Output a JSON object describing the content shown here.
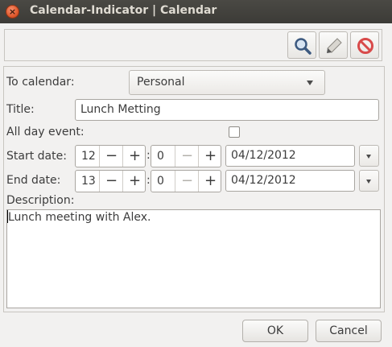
{
  "window": {
    "title": "Calendar-Indicator | Calendar",
    "close_glyph": "×"
  },
  "toolbar": {
    "icons": [
      "search-icon",
      "edit-pencil-icon",
      "delete-no-icon"
    ]
  },
  "form": {
    "to_calendar": {
      "label": "To calendar:",
      "value": "Personal"
    },
    "title": {
      "label": "Title:",
      "value": "Lunch Metting"
    },
    "all_day": {
      "label": "All day event:",
      "checked": false
    },
    "start": {
      "label": "Start date:",
      "hour": "12",
      "minute": "0",
      "date": "04/12/2012"
    },
    "end": {
      "label": "End date:",
      "hour": "13",
      "minute": "0",
      "date": "04/12/2012"
    },
    "spin": {
      "minus": "−",
      "plus": "+",
      "colon": ":"
    },
    "description": {
      "label": "Description:",
      "value": "Lunch meeting with Alex."
    }
  },
  "buttons": {
    "ok": "OK",
    "cancel": "Cancel"
  }
}
